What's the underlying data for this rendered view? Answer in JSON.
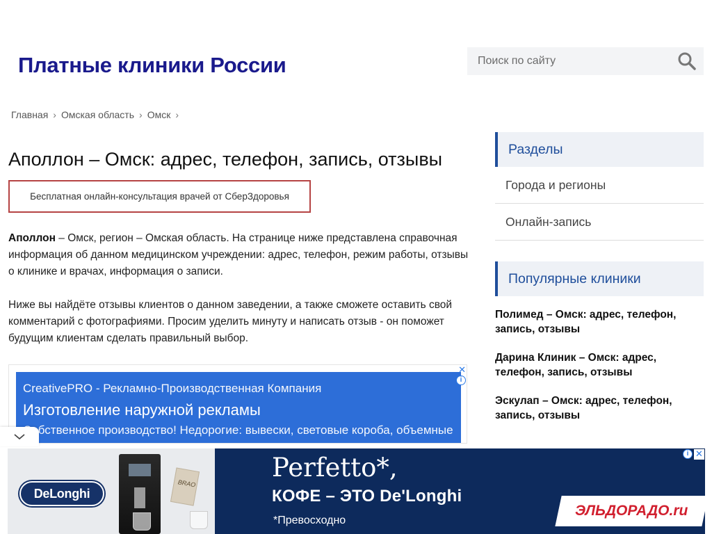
{
  "header": {
    "site_title": "Платные клиники России",
    "search_placeholder": "Поиск по сайту"
  },
  "breadcrumb": [
    "Главная",
    "Омская область",
    "Омск"
  ],
  "breadcrumb_separator": "›",
  "main": {
    "title": "Аполлон – Омск: адрес, телефон, запись, отзывы",
    "consult_button": "Бесплатная онлайн-консультация врачей от СберЗдоровья",
    "intro_bold": "Аполлон",
    "intro_text": " – Омск, регион – Омская область. На странице ниже представлена справочная информация об данном медицинском учреждении: адрес, телефон, режим работы, отзывы о клинике и врачах, информация о записи.",
    "reviews_note": "Ниже вы найдёте отзывы клиентов о данном заведении, а также сможете оставить свой комментарий с фотографиями. Просим уделить минуту и написать отзыв - он поможет будущим клиентам сделать правильный выбор."
  },
  "inline_ad": {
    "company": "CreativePRO - Рекламно-Производственная Компания",
    "headline": "Изготовление наружной рекламы",
    "description": "Собственное производство! Недорогие: вывески, световые короба, объемные буквы",
    "info_glyph": "i",
    "close_glyph": "✕"
  },
  "sidebar": {
    "sections_heading": "Разделы",
    "sections": [
      "Города и регионы",
      "Онлайн-запись"
    ],
    "popular_heading": "Популярные клиники",
    "clinics": [
      "Полимед – Омск: адрес, телефон, запись, отзывы",
      "Дарина Клиник – Омск: адрес, телефон, запись, отзывы",
      "Эскулап – Омск: адрес, телефон, запись, отзывы"
    ]
  },
  "bottom_banner": {
    "brand": "DeLonghi",
    "bag_label": "BRAO",
    "headline": "Perfetto*,",
    "subline": "КОФЕ – ЭТО De'Longhi",
    "slogan": "*Превосходно",
    "retailer": "ЭЛЬДОРАДО.ru",
    "info_glyph": "i",
    "close_glyph": "✕"
  },
  "colors": {
    "title_blue": "#1a1a8c",
    "sidebar_accent": "#1f4e9b",
    "consult_border": "#b54343",
    "ad_blue": "#2d6ed8",
    "banner_navy": "#0d2a5c",
    "eldorado_red": "#d11f2e"
  }
}
